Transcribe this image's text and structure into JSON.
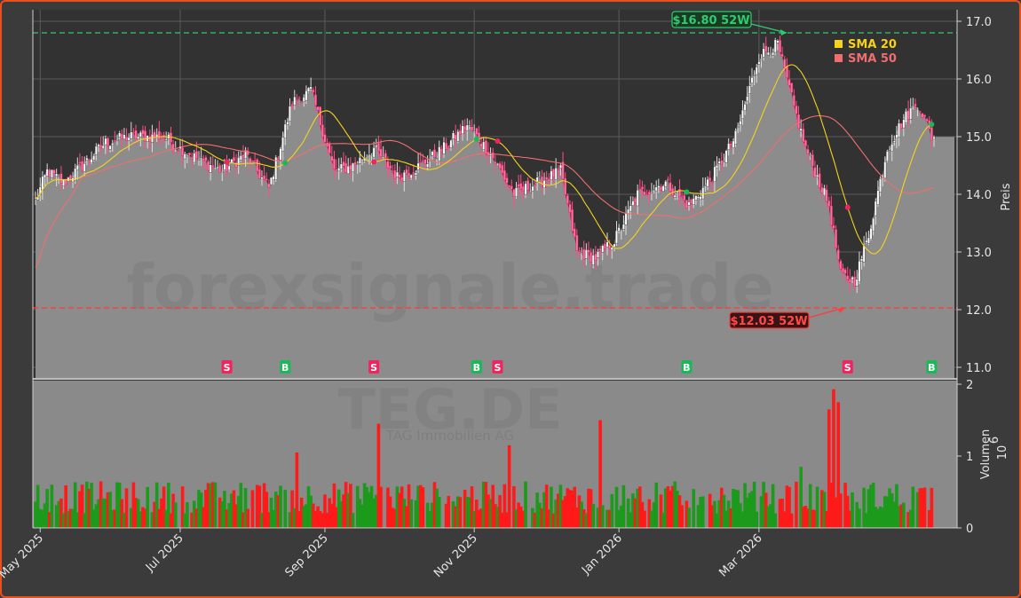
{
  "chart_data": {
    "type": "candlestick",
    "ticker": "TEG.DE",
    "company": "TAG Immobilien AG",
    "watermark": "forexsignale.trade",
    "price_axis": {
      "label": "Preis",
      "ylim": [
        10.8,
        17.2
      ],
      "ticks": [
        "11.0",
        "12.0",
        "13.0",
        "14.0",
        "15.0",
        "16.0",
        "17.0"
      ]
    },
    "volume_axis": {
      "label": "Volumen",
      "unit": "10",
      "unit_exp": "6",
      "ylim": [
        0,
        2.05
      ],
      "ticks": [
        "0",
        "1",
        "2"
      ]
    },
    "x_axis": {
      "ticks": [
        "May 2025",
        "Jul 2025",
        "Sep 2025",
        "Nov 2025",
        "Jan 2026",
        "Mar 2026"
      ]
    },
    "high_52w": {
      "value": 16.8,
      "label": "$16.80 52W"
    },
    "low_52w": {
      "value": 12.03,
      "label": "$12.03 52W"
    },
    "legend": [
      {
        "name": "SMA 20",
        "color": "#f5d21b"
      },
      {
        "name": "SMA 50",
        "color": "#f06e6e"
      }
    ],
    "price_key": [
      [
        0,
        13.9
      ],
      [
        5,
        14.4
      ],
      [
        12,
        14.2
      ],
      [
        20,
        14.5
      ],
      [
        30,
        14.9
      ],
      [
        40,
        15.0
      ],
      [
        55,
        15.0
      ],
      [
        62,
        14.8
      ],
      [
        70,
        14.6
      ],
      [
        80,
        14.4
      ],
      [
        90,
        14.7
      ],
      [
        100,
        14.1
      ],
      [
        110,
        15.6
      ],
      [
        118,
        15.8
      ],
      [
        128,
        14.4
      ],
      [
        136,
        14.5
      ],
      [
        145,
        14.8
      ],
      [
        155,
        14.3
      ],
      [
        165,
        14.5
      ],
      [
        175,
        14.8
      ],
      [
        185,
        15.2
      ],
      [
        195,
        14.7
      ],
      [
        205,
        14.0
      ],
      [
        215,
        14.2
      ],
      [
        225,
        14.4
      ],
      [
        232,
        13.0
      ],
      [
        240,
        12.9
      ],
      [
        248,
        13.2
      ],
      [
        258,
        14.0
      ],
      [
        270,
        14.2
      ],
      [
        280,
        13.8
      ],
      [
        290,
        14.3
      ],
      [
        300,
        15.0
      ],
      [
        310,
        16.4
      ],
      [
        318,
        16.6
      ],
      [
        325,
        15.5
      ],
      [
        330,
        14.8
      ],
      [
        340,
        13.8
      ],
      [
        345,
        12.6
      ],
      [
        351,
        12.5
      ],
      [
        357,
        13.3
      ],
      [
        365,
        14.8
      ],
      [
        372,
        15.3
      ],
      [
        378,
        15.6
      ],
      [
        384,
        15.0
      ]
    ],
    "signals": [
      {
        "type": "S",
        "index": 82
      },
      {
        "type": "B",
        "index": 107
      },
      {
        "type": "S",
        "index": 145
      },
      {
        "type": "B",
        "index": 189
      },
      {
        "type": "S",
        "index": 198
      },
      {
        "type": "B",
        "index": 279
      },
      {
        "type": "S",
        "index": 348
      },
      {
        "type": "B",
        "index": 384
      }
    ],
    "spike_volumes": [
      [
        147,
        1.45
      ],
      [
        203,
        1.15
      ],
      [
        242,
        1.5
      ],
      [
        340,
        1.65
      ],
      [
        342,
        1.93
      ],
      [
        344,
        1.75
      ],
      [
        346,
        1.82
      ],
      [
        336,
        1.12
      ],
      [
        112,
        1.05
      ],
      [
        328,
        0.85
      ]
    ]
  }
}
